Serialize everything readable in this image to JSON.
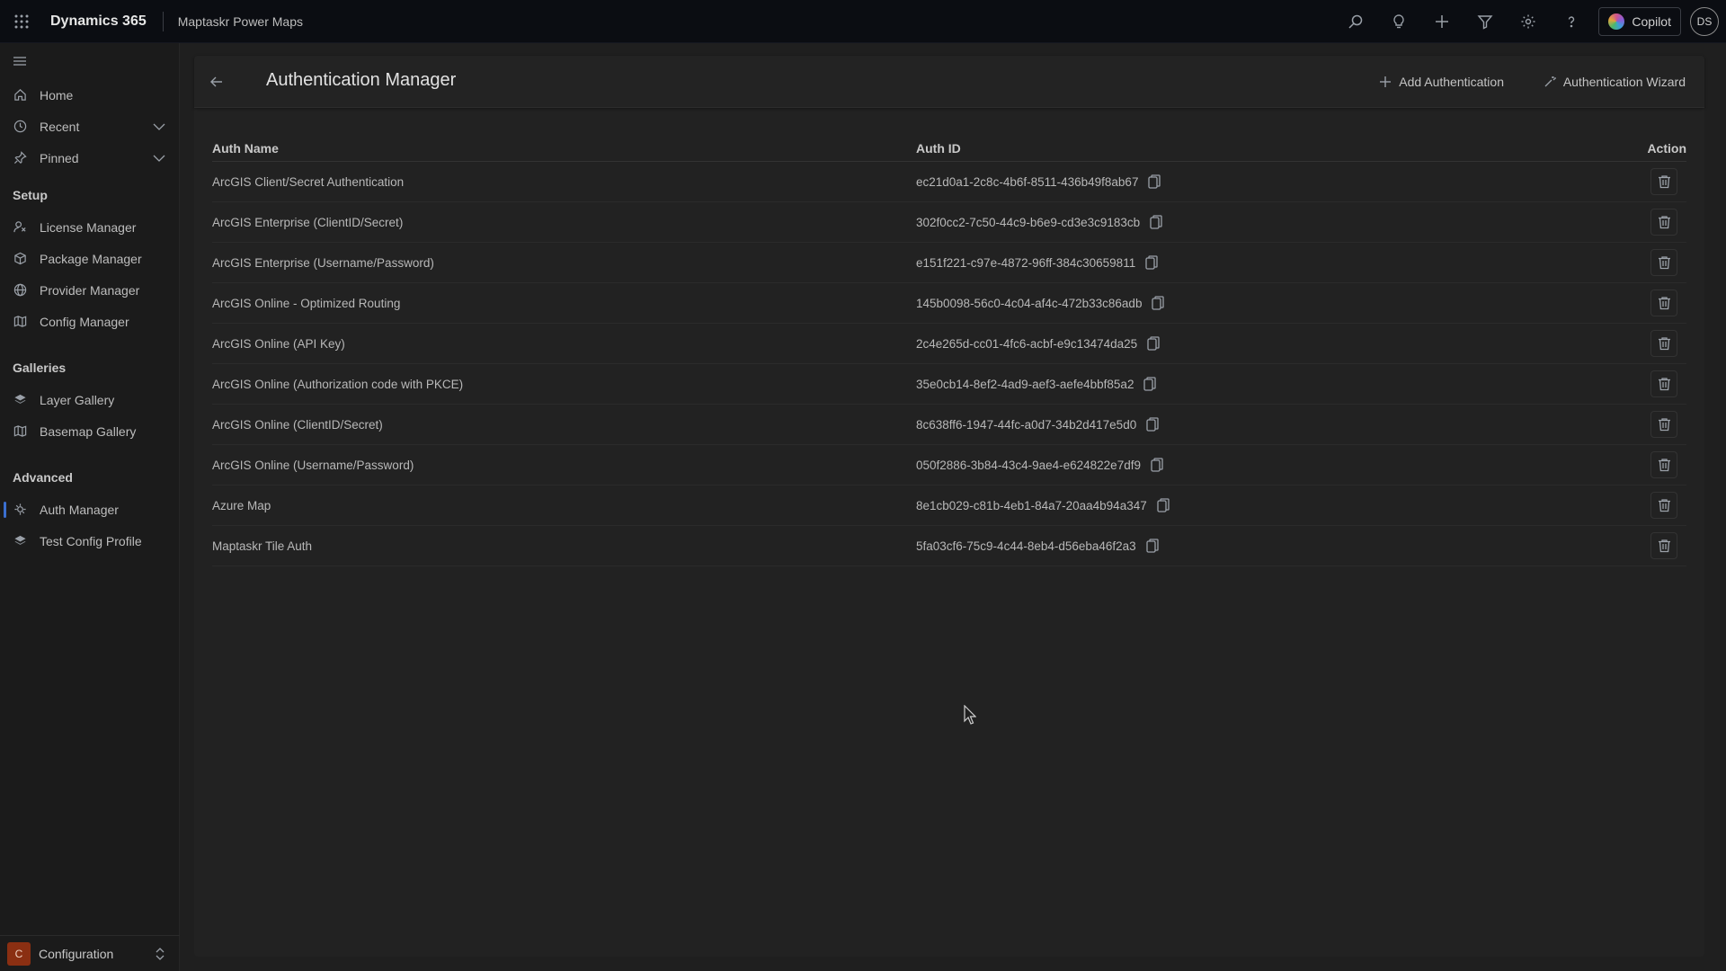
{
  "topbar": {
    "app_name": "Dynamics 365",
    "module_name": "Maptaskr Power Maps",
    "copilot_label": "Copilot",
    "avatar_initials": "DS",
    "icons": [
      "waffle-icon",
      "search-icon",
      "lightbulb-icon",
      "plus-icon",
      "filter-icon",
      "gear-icon",
      "help-icon"
    ]
  },
  "sidebar": {
    "top_items": [
      {
        "label": "Home",
        "icon": "home-icon"
      },
      {
        "label": "Recent",
        "icon": "clock-icon"
      },
      {
        "label": "Pinned",
        "icon": "pin-icon"
      }
    ],
    "sections": [
      {
        "title": "Setup",
        "items": [
          {
            "label": "License Manager",
            "icon": "license-icon"
          },
          {
            "label": "Package Manager",
            "icon": "package-icon"
          },
          {
            "label": "Provider Manager",
            "icon": "globe-icon"
          },
          {
            "label": "Config Manager",
            "icon": "map-icon"
          }
        ]
      },
      {
        "title": "Galleries",
        "items": [
          {
            "label": "Layer Gallery",
            "icon": "layers-icon"
          },
          {
            "label": "Basemap Gallery",
            "icon": "basemap-icon"
          }
        ]
      },
      {
        "title": "Advanced",
        "items": [
          {
            "label": "Auth Manager",
            "icon": "auth-icon"
          },
          {
            "label": "Test Config Profile",
            "icon": "test-icon"
          }
        ]
      }
    ],
    "footer": {
      "badge": "C",
      "label": "Configuration"
    }
  },
  "main": {
    "title": "Authentication Manager",
    "add_label": "Add Authentication",
    "wizard_label": "Authentication Wizard",
    "columns": {
      "name": "Auth Name",
      "id": "Auth ID",
      "action": "Action"
    },
    "rows": [
      {
        "name": "ArcGIS Client/Secret Authentication",
        "id": "ec21d0a1-2c8c-4b6f-8511-436b49f8ab67"
      },
      {
        "name": "ArcGIS Enterprise (ClientID/Secret)",
        "id": "302f0cc2-7c50-44c9-b6e9-cd3e3c9183cb"
      },
      {
        "name": "ArcGIS Enterprise (Username/Password)",
        "id": "e151f221-c97e-4872-96ff-384c30659811"
      },
      {
        "name": "ArcGIS Online - Optimized Routing",
        "id": "145b0098-56c0-4c04-af4c-472b33c86adb"
      },
      {
        "name": "ArcGIS Online (API Key)",
        "id": "2c4e265d-cc01-4fc6-acbf-e9c13474da25"
      },
      {
        "name": "ArcGIS Online (Authorization code with PKCE)",
        "id": "35e0cb14-8ef2-4ad9-aef3-aefe4bbf85a2"
      },
      {
        "name": "ArcGIS Online (ClientID/Secret)",
        "id": "8c638ff6-1947-44fc-a0d7-34b2d417e5d0"
      },
      {
        "name": "ArcGIS Online (Username/Password)",
        "id": "050f2886-3b84-43c4-9ae4-e624822e7df9"
      },
      {
        "name": "Azure Map",
        "id": "8e1cb029-c81b-4eb1-84a7-20aa4b94a347"
      },
      {
        "name": "Maptaskr Tile Auth",
        "id": "5fa03cf6-75c9-4c44-8eb4-d56eba46f2a3"
      }
    ]
  }
}
